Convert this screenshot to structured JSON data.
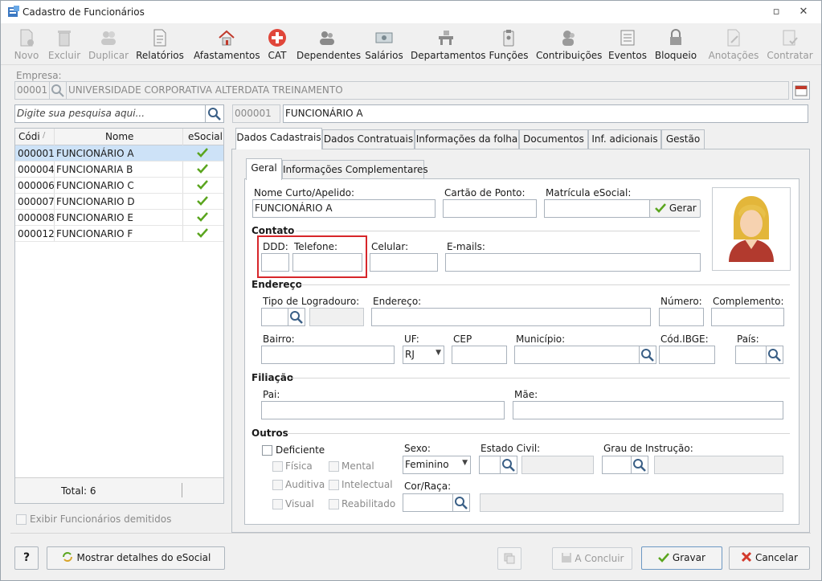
{
  "window": {
    "title": "Cadastro de Funcionários"
  },
  "toolbar": {
    "novo": "Novo",
    "excluir": "Excluir",
    "duplicar": "Duplicar",
    "relatorios": "Relatórios",
    "afastamentos": "Afastamentos",
    "cat": "CAT",
    "dependentes": "Dependentes",
    "salarios": "Salários",
    "departamentos": "Departamentos",
    "funcoes": "Funções",
    "contribuicoes": "Contribuições",
    "eventos": "Eventos",
    "bloqueio": "Bloqueio",
    "anotacoes": "Anotações",
    "contratar": "Contratar"
  },
  "empresa": {
    "label": "Empresa:",
    "code": "00001",
    "name": "UNIVERSIDADE CORPORATIVA ALTERDATA TREINAMENTO"
  },
  "search": {
    "placeholder": "Digite sua pesquisa aqui..."
  },
  "selected": {
    "code": "000001",
    "name": "FUNCIONÁRIO A"
  },
  "grid": {
    "col_code": "Códi",
    "col_name": "Nome",
    "col_esocial": "eSocial",
    "rows": [
      {
        "code": "000001",
        "name": "FUNCIONÁRIO A"
      },
      {
        "code": "000004",
        "name": "FUNCIONARIA B"
      },
      {
        "code": "000006",
        "name": "FUNCIONARIO C"
      },
      {
        "code": "000007",
        "name": "FUNCIONARIO D"
      },
      {
        "code": "000008",
        "name": "FUNCIONARIO E"
      },
      {
        "code": "000012",
        "name": "FUNCIONARIO F"
      }
    ],
    "total": "Total: 6"
  },
  "exibir_demitidos": "Exibir Funcionários demitidos",
  "tabs": [
    "Dados Cadastrais",
    "Dados Contratuais",
    "Informações da folha",
    "Documentos",
    "Inf. adicionais",
    "Gestão"
  ],
  "subtabs": [
    "Geral",
    "Informações Complementares"
  ],
  "form": {
    "nome_curto_label": "Nome Curto/Apelido:",
    "nome_curto_value": "FUNCIONÁRIO A",
    "cartao_ponto_label": "Cartão de Ponto:",
    "matricula_label": "Matrícula eSocial:",
    "gerar": "Gerar",
    "contato": "Contato",
    "ddd": "DDD:",
    "telefone": "Telefone:",
    "celular": "Celular:",
    "emails": "E-mails:",
    "endereco_sec": "Endereço",
    "tipo_logradouro": "Tipo de Logradouro:",
    "endereco": "Endereço:",
    "numero": "Número:",
    "complemento": "Complemento:",
    "bairro": "Bairro:",
    "uf": "UF:",
    "uf_value": "RJ",
    "cep": "CEP",
    "municipio": "Município:",
    "cod_ibge": "Cód.IBGE:",
    "pais": "País:",
    "filiacao": "Filiação",
    "pai": "Pai:",
    "mae": "Mãe:",
    "outros": "Outros",
    "deficiente": "Deficiente",
    "fisica": "Física",
    "mental": "Mental",
    "auditiva": "Auditiva",
    "intelectual": "Intelectual",
    "visual": "Visual",
    "reabilitado": "Reabilitado",
    "sexo": "Sexo:",
    "sexo_value": "Feminino",
    "estado_civil": "Estado Civil:",
    "grau_instrucao": "Grau de Instrução:",
    "cor_raca": "Cor/Raça:"
  },
  "bottom": {
    "help": "?",
    "detalhes": "Mostrar detalhes do eSocial",
    "concluir": "A Concluir",
    "gravar": "Gravar",
    "cancelar": "Cancelar"
  },
  "colors": {
    "accent_selection": "#cde2f7",
    "highlight_box": "#d7262a",
    "check_green": "#5aa51e",
    "cancel_red": "#d33a2c"
  }
}
